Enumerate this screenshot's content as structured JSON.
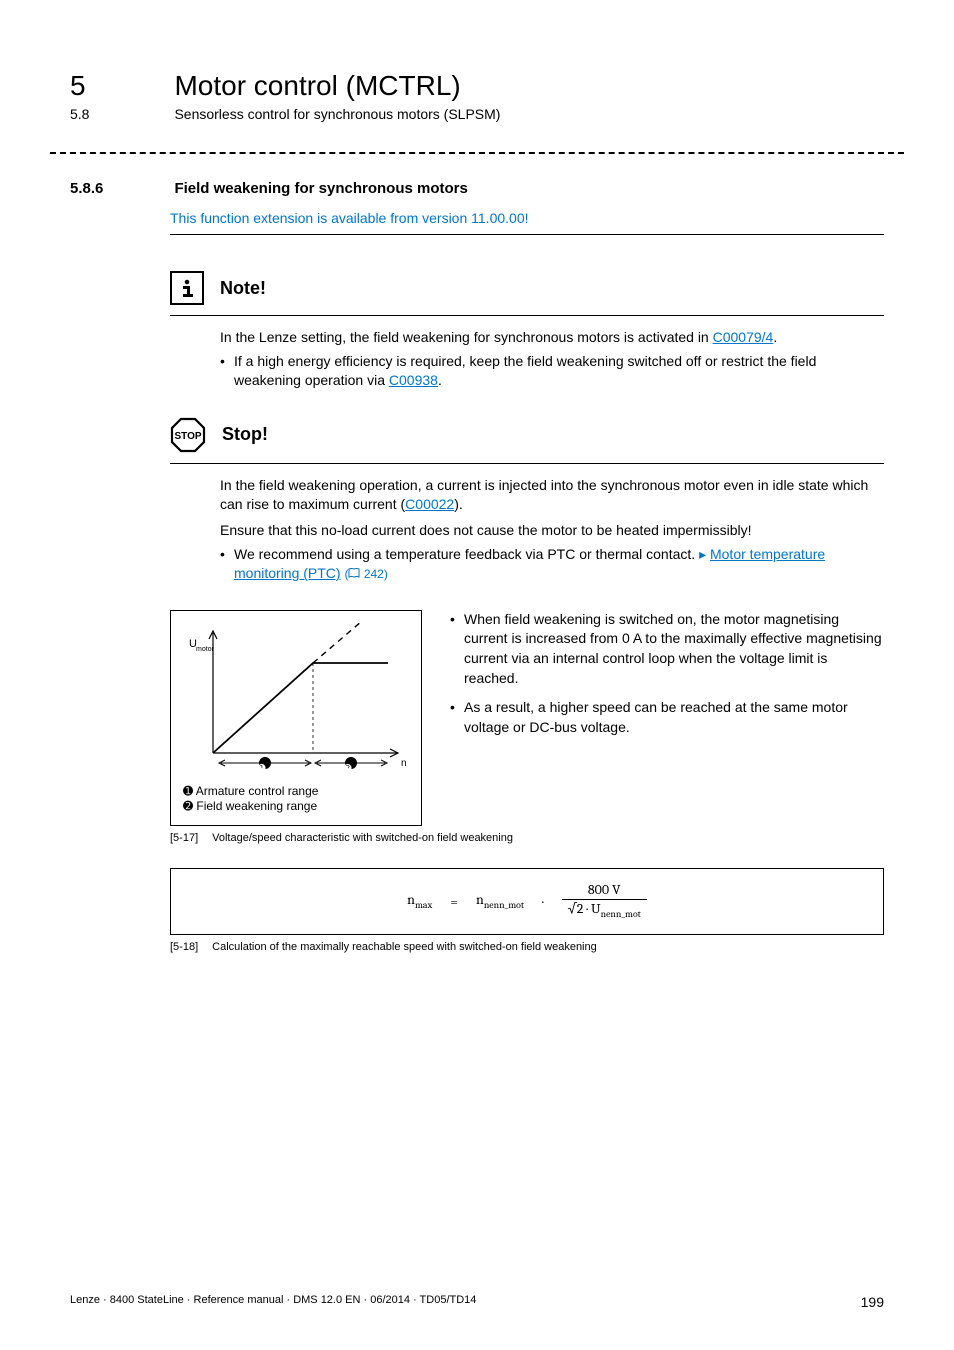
{
  "header": {
    "chapter_num": "5",
    "chapter_title": "Motor control (MCTRL)",
    "sub_num": "5.8",
    "sub_title": "Sensorless control for synchronous motors (SLPSM)"
  },
  "section": {
    "num": "5.8.6",
    "title": "Field weakening for synchronous motors",
    "version_note": "This function extension is available from version 11.00.00!"
  },
  "note_box": {
    "title": "Note!",
    "p1_a": "In the Lenze setting, the field weakening for synchronous motors is activated in ",
    "p1_link": "C00079/4",
    "p1_b": ".",
    "li1_a": "If a high energy efficiency is required, keep the field weakening switched off or restrict the field weakening operation via ",
    "li1_link": "C00938",
    "li1_b": "."
  },
  "stop_box": {
    "title": "Stop!",
    "p1_a": "In the field weakening operation, a current is injected into the synchronous motor even in idle state which can rise to maximum current (",
    "p1_link": "C00022",
    "p1_b": ").",
    "p2": "Ensure that this no-load current does not cause the motor to be heated impermissibly!",
    "li1_a": "We recommend using a temperature feedback via PTC or thermal contact.  ",
    "li1_link": "Motor temperature monitoring (PTC)",
    "li1_page": " 242)"
  },
  "figure17": {
    "y_label": "U",
    "y_sub": "motor",
    "x_label": "n",
    "marker1": "➊",
    "marker2": "➋",
    "legend1": "➊ Armature control range",
    "legend2": "➋ Field weakening range",
    "side_li1": "When field weakening is switched on, the motor magnetising current is increased from 0 A to the maximally effective magnetising current via an internal control loop when the voltage limit is reached.",
    "side_li2": "As a result, a higher speed can be reached at the same motor voltage or DC-bus voltage.",
    "cap_tag": "[5-17]",
    "cap_text": "Voltage/speed characteristic with switched-on field weakening"
  },
  "figure18": {
    "cap_tag": "[5-18]",
    "cap_text": "Calculation of the maximally reachable speed with switched-on field weakening"
  },
  "chart_data": {
    "type": "line",
    "title": "Voltage/speed characteristic with switched-on field weakening",
    "xlabel": "n",
    "ylabel": "Umotor",
    "series": [
      {
        "name": "Motor voltage (solid)",
        "x": [
          0,
          0.55,
          1.0
        ],
        "y": [
          0,
          0.85,
          0.85
        ]
      },
      {
        "name": "Linear extrapolation (dashed)",
        "x": [
          0.55,
          1.0
        ],
        "y": [
          0.85,
          1.55
        ]
      }
    ],
    "regions": [
      {
        "name": "Armature control range",
        "x_range": [
          0,
          0.55
        ]
      },
      {
        "name": "Field weakening range",
        "x_range": [
          0.55,
          1.0
        ]
      }
    ],
    "axes_note": "Qualitative plot, no numeric tick labels shown"
  },
  "formula": {
    "lhs": "n",
    "lhs_sub": "max",
    "eq": "=",
    "mid": "n",
    "mid_sub": "nenn_mot",
    "dot": "·",
    "num": "800 V",
    "den_a": "√2 · U",
    "den_sub": "nenn_mot"
  },
  "footer": {
    "left": "Lenze · 8400 StateLine · Reference manual · DMS 12.0 EN · 06/2014 · TD05/TD14",
    "page": "199"
  }
}
